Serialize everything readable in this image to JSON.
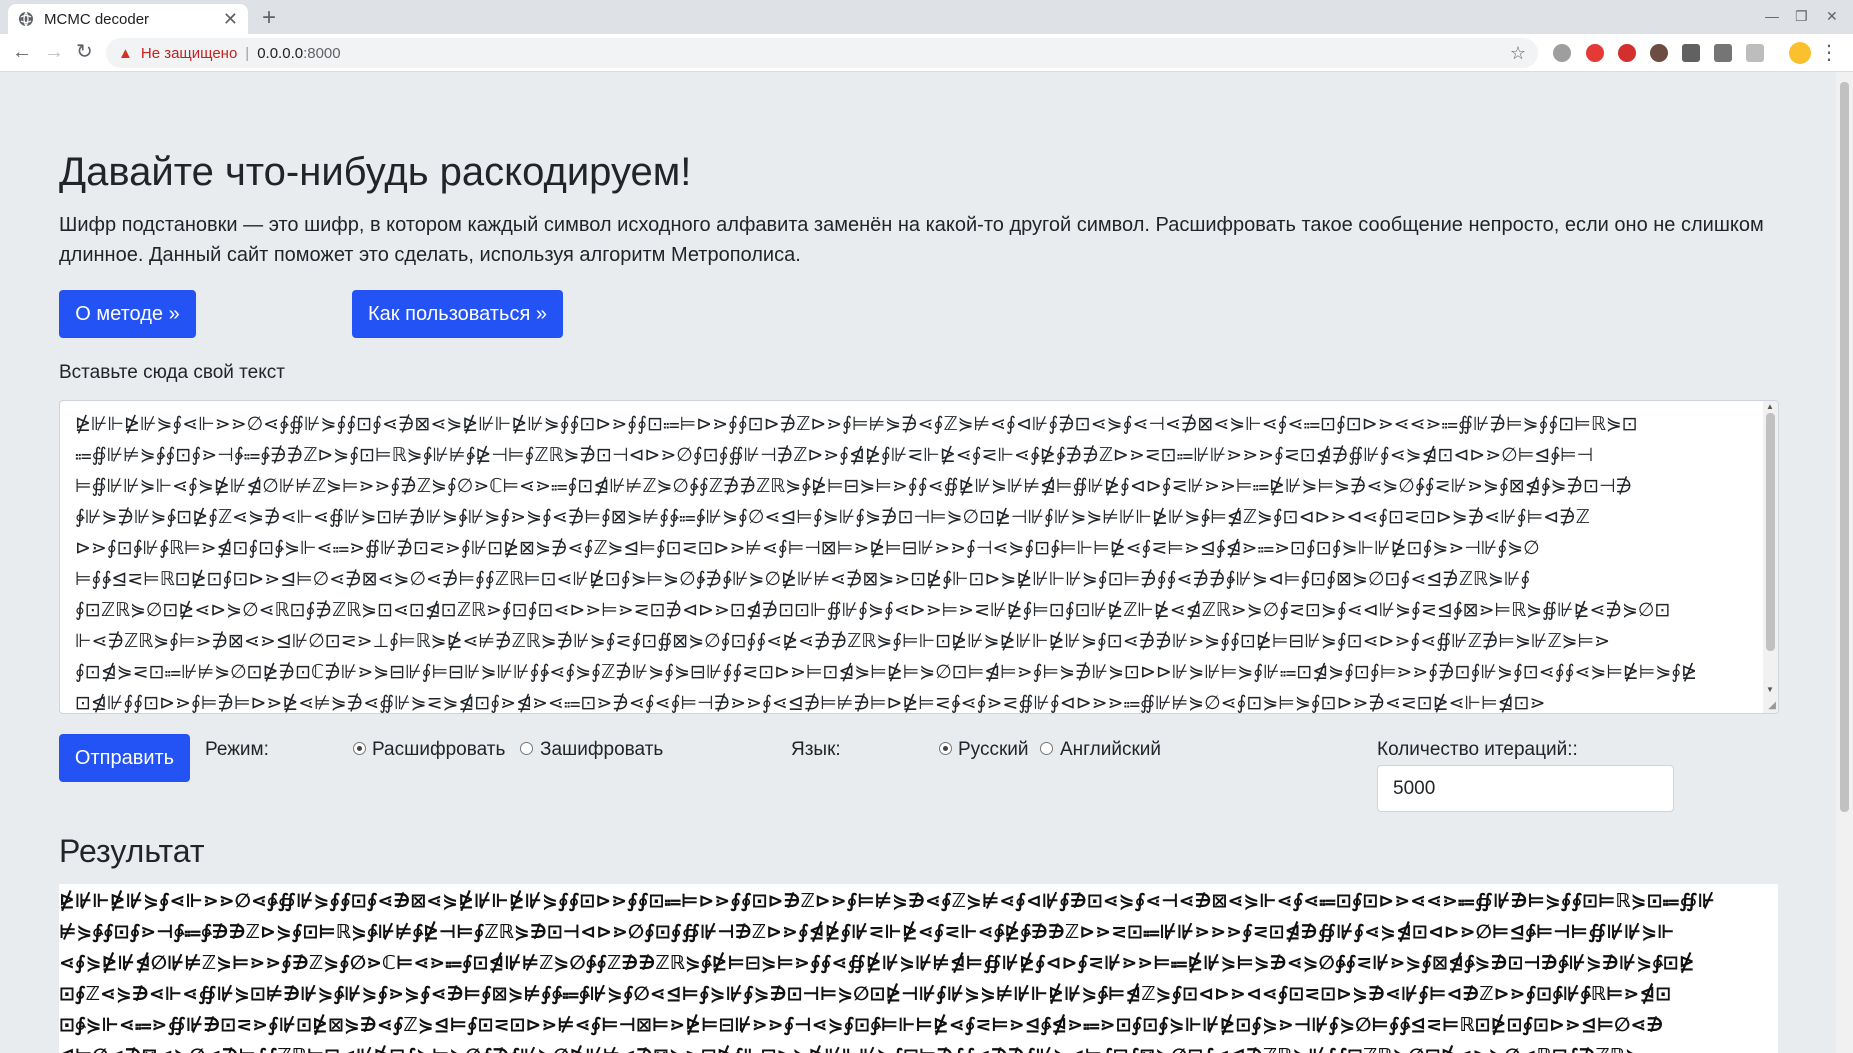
{
  "browser": {
    "tab_title": "MCMC decoder",
    "tab_close": "✕",
    "new_tab": "+",
    "security_label": "Не защищено",
    "url_host": "0.0.0.0",
    "url_port": ":8000"
  },
  "hero": {
    "title": "Давайте что-нибудь раскодируем!",
    "lead": "Шифр подстановки — это шифр, в котором каждый символ исходного алфавита заменён на какой-то другой символ. Расшифровать такое сообщение непросто, если оно не слишком длинное. Данный сайт поможет это сделать, используя алгоритм Метрополиса.",
    "about_button": "О методе »",
    "howto_button": "Как пользоваться »"
  },
  "form": {
    "input_label": "Вставьте сюда свой текст",
    "cipher_lines": [
      "⋭⊮⊩⋭⊮⋟∮⋖⊩⋗⋗∅⋖∳∯⊮⋟∮∮⊡∮⋖∌⊠⋖⋟⋭⊮⊩⋭⊮⋟∮∮⊡⊳⋗∮∮⊡⩴⊨⊳⋗∮∮⊡⊳∌ℤ⊳⋗∮⊨⊭⋟∌⋖∮ℤ⋟⊭⋖∮⊲⊮∮∌⊡⋖⋟∮⋖⊣⋖∌⊠⋖⋟⊩⋖∮⋖⩴⊡∮⊡⊳⋗⋖⋖⋗⩴∯⊮∌⊨⋟∮∮⊡⊨ℝ⋟⊡",
      "⩴∯⊮⊭⋟∳∮⊡∮⋗⊣∳⩴∳∌∌ℤ⊳⋟∮⊡⊨ℝ⋟∳⊮⊭∳⋭⊣⊨∮ℤℝ⋟∌⊡⊣⊲⊳⋗∅∮⊡∮∯⊮⊣∌ℤ⊳⋗∮⋬⋭∮⊮⋜⊩⋭⋖∮⋜⊩⋖∳⋭∳∌∌ℤ⊳⋗⋜⊡⩴⊮⊮⋗⋗⋗∮⋜⊡⋬∌∯⊮∮⋖⋟⋬⊡⊲⊳⋗∅⊨⊴∳⊨⊣",
      "⊨∯⊮⊮⋟⊩⋖∮⋟⋭⊮⋬∅⊮⊭ℤ⋟⊨⋗⋗∮∌ℤ⋟∮∅⋗ℂ⊨⋖⋗⩴∮⊡⋬⊮⊭ℤ⋟∅∳∮ℤ∌∌ℤℝ⋟∳⋭⊨⊟⋟⊨⋗∮∮⋖∯⋭⊮⋟⊮⊭⋬⊨∯⊮⋭∮⊲⊳∮⋜⊮⋗⋗⊨⩴⋭⊮⋟⊨⋟∌⋖⋟∅∳∮⋜⊮⋗⋟∮⊠⋬∳⋟∌⊡⊣∌",
      "∳⊮⋟∌⊮⋟∳⊡⋭∮ℤ⋖⋟∌⋖⊩⋖∯⊮⋟⊡⊭∌⊮⋟∳⊮⋟∮⋗⋟∮⋖∌⊨∮⊠⋟⊭∮∳⩴∳⊮⋟∮∅⋖⊴⊨∮⋟⊮∮⋟∌⊡⊣⊨⋟∅⊡⋭⊣⊮∮⊮⋟⋟⊭⊮⊩⋭⊮⋟∳⊨⋬ℤ⋟∮⊡⊲⊳⋗⊲⋖∮⊡⋜⊡⊳⋟∌⋖⊮∮⊨⊲∌ℤ",
      "⊳⋗∮⊡∳⊮∳ℝ⊨⋗⋬⊡∮⊡∳⋟⊩⋖⩴⋗∯⊮∌⊡⋜⋗∮⊮⊡⋭⊠⋟∌⋖∮ℤ⋟⊴⊨∮⊡⋜⊡⊳⋗⊭⋖∮⊨⊣⊠⊨⋗⋭⊨⊟⊮⋗⋗∮⊣⋖⋟∮⊡∳⊨⊩⊨⋭⋖∮⋜⊨⋗⊴∳⋬⋗⩴⋗⊡∮⊡∮⋟⊩⊮⋭⊡∮⋟⋗⊣⊮∮⋟∅",
      "⊨∮∳⊴⋜⊨ℝ⊡⋭⊡∮⊡⊳⋗⊴⊨∅⋖∌⊠⋖⋟∅⋖∌⊨∮∮ℤℝ⊨⊡⋖⊮⋭⊡∮⋟⊨⋟∅∳∌∳⊮⋟∅⋭⊮⊭⋖∌⊠⋟⋗⊡⋭∳⊩⊡⊳⋟⋭⊮⊩⊮⋟∮⊡⊨∌∮∮⋖∌∌∳⊮⋟⊲⊨∮⊡∮⊠⋟∅⊡∮⋖⊴∌ℤℝ⋟⊮∮",
      "∮⊡ℤℝ⋟∅⊡⋭⋖⊳⋟∅⋖ℝ⊡∮∌ℤℝ⋟⊡⋖⊡⋬⊡ℤℝ⋗∮⊡∮⊡⋖⊳⋗⊨⋗⋜⊡∌⊲⊳⋗⊡⋬∌⊡⊡⊩∯⊮∮⋟∮⋖⊳⋗⊨⋗⋜⊮⋭∮⊨⊡∮⊡⊮⋭ℤ⊩⋭⋖⋬ℤℝ⋗⋟∅∮⋜⊡⋟∮⋖⊲⊮⋟∮⋜⊴∳⊠⋗⊨ℝ⋟∯⊮⋭⋖∌⋟∅⊡",
      "⊩⋖∌ℤℝ⋟∮⊨⋗∌⊠⋖⋗⊴⊮∅⊡⋜⋗⊥∮⊨ℝ⋟⋭⋖⊭∌ℤℝ⋟∌⊮⋟∮⋜∮⊡∯⊠⋟∅∮⊡∮∮⋖⋭⋖∌∌ℤℝ⋟∮⊨⊩⊡⋭⊮⋟⋭⊮⊩⋭⊮⋟∮⊡⋖∌∌⊮⋗⋟∮∮⊡⋭⊨⊟⊮⋟∮⊡⋖⊳⋗∮⋖∯⊮ℤ∌⊨⋟⊮ℤ⋟⊨⋗",
      "∮⊡⋬⋟⋜⊡⩴⊮⊭⋟∅⊡⋭∌⊡ℂ∌⊮⋗⋟⊟⊮∮⊨⊟⊮⋟⊮⊮∮∳⋖∮⋟∮ℤ∌⊮⋟∮⋟⊟⊮∮∮⋜⊡⊳⋗⊨⊡⋬⋟⊨⋭⊨⋟∅⊡⊨⋬⊨⋗∮⊨⋟∌⊮⋟⊡⊳⊳⊮⋟⊮⊨⋟∮⊮⩴⊡⋬⋟∮⊡∮⊨⋗⋗∮∌⊡∮⊮⋟∮⊡⋖∮∮⋖⋟⊨⋭⊨⋟∮⋭",
      "⊡⋬⊮∮∮⊡⊳⋗∮⊨∌⊨⊳⋗⋭⋖⊭⋟∌⋖∯⊮⋟⋜⋟⋬⊡∮⋗⋬⋗⋖⩴⊡⋗∌⋖∮⋖∮⊨⊣∌⋗⋗∮⋖⊴∌⊨⊭∌⊨⊳⋭⊨⋜∳⋖∮⋗⋜∯⊮∮⊲⊳⋗⋗⩴∯⊮⊭⋟∅⋖∮⊡⋟⊨⋟∮⊡⊳⋗∌⋖⋜⊡⋭⋖⊩⊨⋬⊡⋗"
    ],
    "submit_button": "Отправить",
    "mode_label": "Режим:",
    "mode_decrypt": "Расшифровать",
    "mode_encrypt": "Зашифровать",
    "lang_label": "Язык:",
    "lang_russian": "Русский",
    "lang_english": "Английский",
    "iterations_label": "Количество итераций::",
    "iterations_value": "5000"
  },
  "result": {
    "title": "Результат",
    "lines": [
      "⋭⊮⊩⋭⊮⋟∮⋖⊩⋗⋗∅⋖∳∯⊮⋟∮∮⊡∮⋖∌⊠⋖⋟⋭⊮⊩⋭⊮⋟∮∮⊡⊳⋗∮∮⊡⩴⊨⊳⋗∮∮⊡⊳∌ℤ⊳⋗∮⊨⊭⋟∌⋖∮ℤ⋟⊭⋖∮⊲⊮∮∌⊡⋖⋟∮⋖⊣⋖∌⊠⋖⋟⊩⋖∮⋖⩴⊡∮⊡⊳⋗⋖⋖⋗⩴∯⊮∌⊨⋟∮∮⊡⊨ℝ⋟⊡⩴∯⊮",
      "⊭⋟∳∮⊡∮⋗⊣∳⩴∳∌∌ℤ⊳⋟∮⊡⊨ℝ⋟∳⊮⊭∳⋭⊣⊨∮ℤℝ⋟∌⊡⊣⊲⊳⋗∅∮⊡∮∯⊮⊣∌ℤ⊳⋗∮⋬⋭∮⊮⋜⊩⋭⋖∮⋜⊩⋖∳⋭∳∌∌ℤ⊳⋗⋜⊡⩴⊮⊮⋗⋗⋗∮⋜⊡⋬∌∯⊮∮⋖⋟⋬⊡⊲⊳⋗∅⊨⊴∳⊨⊣⊨∯⊮⊮⋟⊩",
      "⋖∮⋟⋭⊮⋬∅⊮⊭ℤ⋟⊨⋗⋗∮∌ℤ⋟∮∅⋗ℂ⊨⋖⋗⩴∮⊡⋬⊮⊭ℤ⋟∅∳∮ℤ∌∌ℤℝ⋟∳⋭⊨⊟⋟⊨⋗∮∮⋖∯⋭⊮⋟⊮⊭⋬⊨∯⊮⋭∮⊲⊳∮⋜⊮⋗⋗⊨⩴⋭⊮⋟⊨⋟∌⋖⋟∅∳∮⋜⊮⋗⋟∮⊠⋬∳⋟∌⊡⊣∌∳⊮⋟∌⊮⋟∳⊡⋭",
      "⊡∮ℤ⋖⋟∌⋖⊩⋖∯⊮⋟⊡⊭∌⊮⋟∳⊮⋟∮⋗⋟∮⋖∌⊨∮⊠⋟⊭∮∳⩴∳⊮⋟∮∅⋖⊴⊨∮⋟⊮∮⋟∌⊡⊣⊨⋟∅⊡⋭⊣⊮∮⊮⋟⋟⊭⊮⊩⋭⊮⋟∳⊨⋬ℤ⋟∮⊡⊲⊳⋗⊲⋖∮⊡⋜⊡⊳⋟∌⋖⊮∮⊨⊲∌ℤ⊳⋗∮⊡∳⊮∳ℝ⊨⋗⋬⊡",
      "⊡∳⋟⊩⋖⩴⋗∯⊮∌⊡⋜⋗∮⊮⊡⋭⊠⋟∌⋖∮ℤ⋟⊴⊨∮⊡⋜⊡⊳⋗⊭⋖∮⊨⊣⊠⊨⋗⋭⊨⊟⊮⋗⋗∮⊣⋖⋟∮⊡∳⊨⊩⊨⋭⋖∮⋜⊨⋗⊴∳⋬⋗⩴⋗⊡∮⊡∮⋟⊩⊮⋭⊡∮⋟⋗⊣⊮∮⋟∅⊨∮∳⊴⋜⊨ℝ⊡⋭⊡∮⊡⊳⋗⊴⊨∅⋖∌",
      "⊴⊨∅⋖∌⊠⋖⋟∅⋖∌⊨∮∮ℤℝ⊨⊡⋖⊮⋭⊡∮⋟⊨⋟∅∳∌∳⊮⋟∅⋭⊮⊭⋖∌⊠⋟⋗⊡⋭∳⊩⊡⊳⋟⋭⊮⊩⊮⋟∮⊡⊨∌∮∮⋖∌∌∳⊮⋟⊲⊨∮⊡∮⊠⋟∅⊡∮⋖⊴∌ℤℝ⋟⊮∮∮⊡ℤℝ⋟∅⊡⋭⋖⊳⋟∅⋖ℝ⊡∮∌ℤℝ⋟"
    ]
  }
}
